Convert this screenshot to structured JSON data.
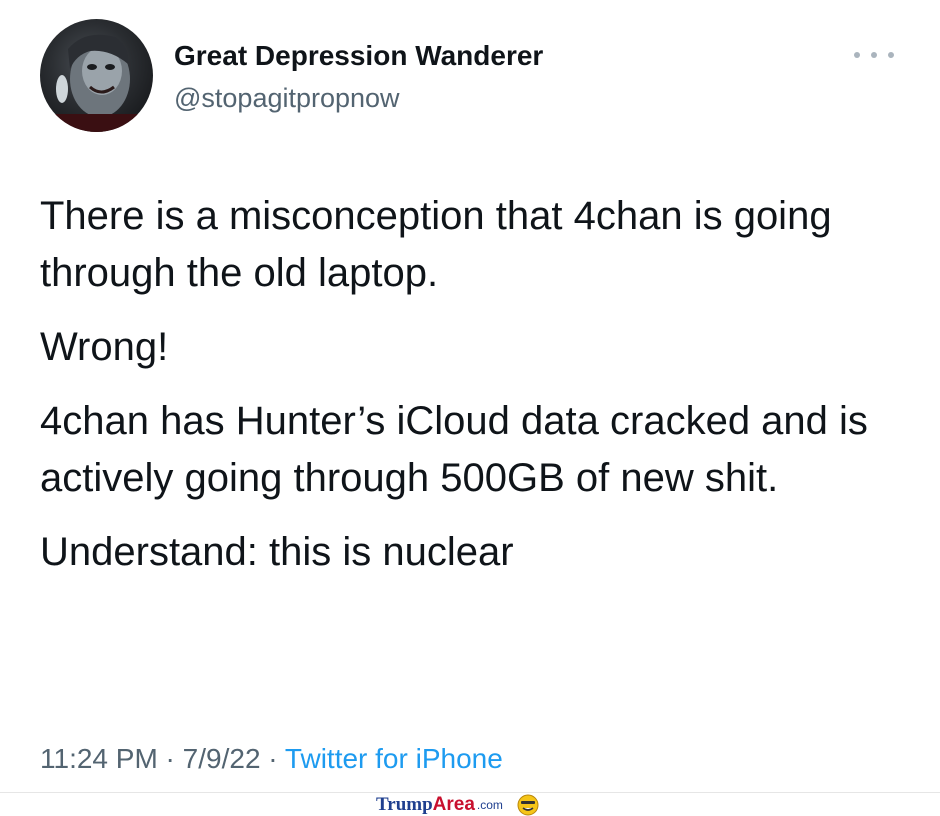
{
  "tweet": {
    "display_name": "Great Depression Wanderer",
    "handle": "@stopagitpropnow",
    "paragraphs": [
      "There is a misconception that 4chan is going through the old laptop.",
      "Wrong!",
      "4chan has Hunter’s iCloud data cracked and is actively going through 500GB of new shit.",
      "Understand: this is nuclear"
    ],
    "time": "11:24 PM",
    "date": "7/9/22",
    "separator": " · ",
    "source": "Twitter for iPhone",
    "more_icon": "ellipsis-icon"
  },
  "watermark": {
    "part1": "Trump",
    "part2": "Area",
    "part3": ".com",
    "icon": "smiley-face-icon"
  },
  "colors": {
    "text": "#0f1419",
    "secondary": "#536471",
    "link": "#1d9bf0",
    "watermark_blue": "#1f3f8f",
    "watermark_red": "#c8102e"
  }
}
